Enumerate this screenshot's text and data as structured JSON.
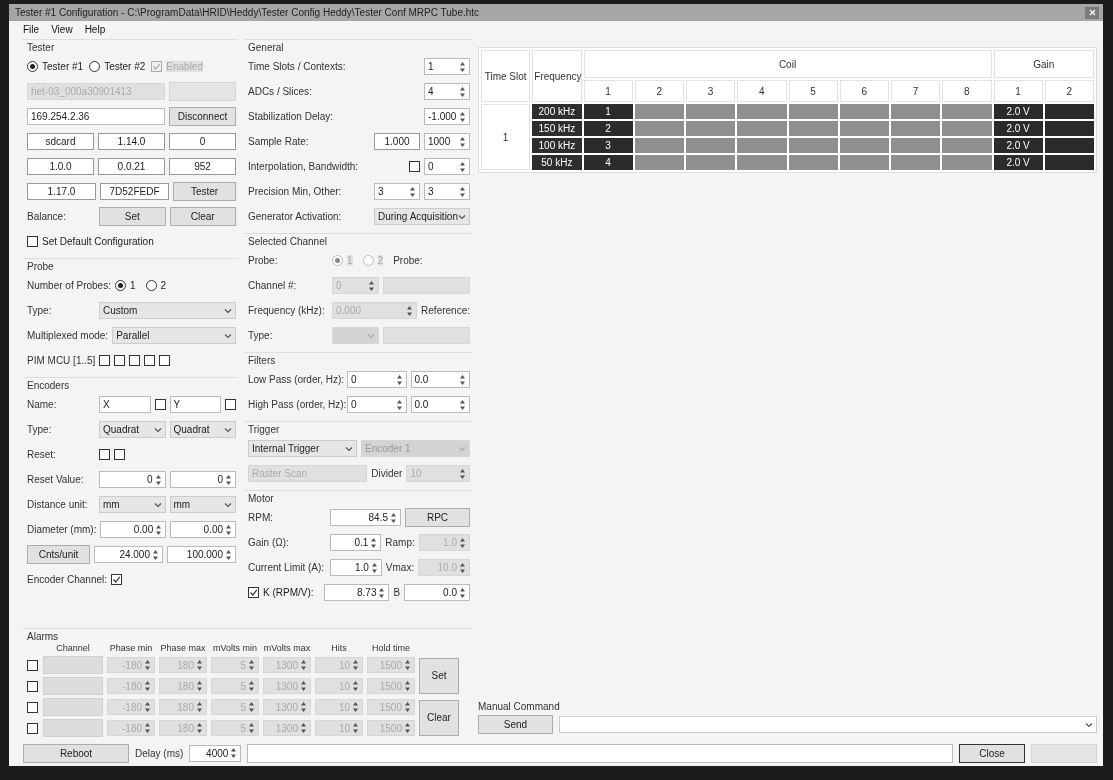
{
  "window": {
    "title": "Tester #1 Configuration - C:\\ProgramData\\HRID\\Heddy\\Tester Config Heddy\\Tester Conf MRPC Tube.htc"
  },
  "menu": [
    {
      "label": "File"
    },
    {
      "label": "View"
    },
    {
      "label": "Help"
    }
  ],
  "left_sections": [
    {
      "title": "Tester",
      "options": [
        {
          "kind": "radio",
          "label": "Tester #1",
          "selected": true,
          "disabled": false
        },
        {
          "kind": "radio",
          "label": "Tester #2",
          "selected": false,
          "disabled": false
        },
        {
          "kind": "check",
          "label": "Enabled",
          "checked": true,
          "disabled": true
        }
      ],
      "fields": [
        [
          {
            "kind": "field",
            "value": "het-03_000a30901413",
            "disabled": true
          },
          {
            "kind": "button",
            "disabled": true
          }
        ],
        [
          {
            "kind": "field",
            "value": "169.254.2.36",
            "disabled": false
          },
          {
            "kind": "button",
            "label": "Disconnect",
            "disabled": false
          }
        ]
      ],
      "readouts": [
        [
          {
            "kind": "box",
            "value": "sdcard"
          },
          {
            "kind": "box",
            "value": "1.14.0"
          },
          {
            "kind": "box",
            "value": "0"
          }
        ],
        [
          {
            "kind": "box",
            "value": "1.0.0"
          },
          {
            "kind": "box",
            "value": "0.0.21"
          },
          {
            "kind": "box",
            "value": "952"
          }
        ],
        [
          {
            "kind": "box",
            "value": "1.17.0"
          },
          {
            "kind": "box",
            "value": "7D52FEDF"
          },
          {
            "kind": "button",
            "label": "Tester",
            "disabled": false
          }
        ]
      ],
      "rows": [
        [
          {
            "kind": "label",
            "text": "Balance:"
          },
          {
            "kind": "button",
            "label": "Set",
            "disabled": false
          },
          {
            "kind": "button",
            "label": "Clear",
            "disabled": false
          }
        ],
        [
          {
            "kind": "check",
            "label": "Set Default Configuration",
            "checked": false,
            "disabled": false
          }
        ]
      ]
    },
    {
      "title": "Probe",
      "rows": [
        [
          {
            "kind": "label",
            "text": "Number of Probes:"
          },
          {
            "kind": "radio",
            "label": "1",
            "selected": true,
            "disabled": false
          },
          {
            "kind": "radio",
            "label": "2",
            "selected": false,
            "disabled": false
          }
        ],
        [
          {
            "kind": "label",
            "text": "Type:"
          },
          {
            "kind": "combo",
            "value": "Custom",
            "disabled": false
          }
        ],
        [
          {
            "kind": "label",
            "text": "Multiplexed mode:"
          },
          {
            "kind": "combo",
            "value": "Parallel",
            "disabled": false
          }
        ],
        [
          {
            "kind": "label",
            "text": "PIM MCU [1..5]"
          },
          {
            "kind": "check",
            "checked": false,
            "disabled": false
          },
          {
            "kind": "check",
            "checked": false,
            "disabled": false
          },
          {
            "kind": "check",
            "checked": false,
            "disabled": false
          },
          {
            "kind": "check",
            "checked": false,
            "disabled": false
          },
          {
            "kind": "check",
            "checked": false,
            "disabled": false
          }
        ]
      ]
    },
    {
      "title": "Encoders",
      "rows": [
        [
          {
            "kind": "label",
            "text": "Name:"
          },
          {
            "kind": "field",
            "value": "X",
            "disabled": false
          },
          {
            "kind": "check",
            "checked": false,
            "disabled": false
          },
          {
            "kind": "field",
            "value": "Y",
            "disabled": false
          },
          {
            "kind": "check",
            "checked": false,
            "disabled": false
          }
        ],
        [
          {
            "kind": "label",
            "text": "Type:"
          },
          {
            "kind": "combo",
            "value": "Quadrat",
            "disabled": false
          },
          {
            "kind": "combo",
            "value": "Quadrat",
            "disabled": false
          }
        ],
        [
          {
            "kind": "label",
            "text": "Reset:"
          },
          {
            "kind": "check",
            "checked": false,
            "disabled": false
          },
          {
            "kind": "check",
            "checked": false,
            "disabled": false
          }
        ],
        [
          {
            "kind": "label",
            "text": "Reset Value:"
          },
          {
            "kind": "spin",
            "value": "0",
            "disabled": false
          },
          {
            "kind": "spin",
            "value": "0",
            "disabled": false
          }
        ],
        [
          {
            "kind": "label",
            "text": "Distance unit:"
          },
          {
            "kind": "combo",
            "value": "mm",
            "disabled": false
          },
          {
            "kind": "combo",
            "value": "mm",
            "disabled": false
          }
        ],
        [
          {
            "kind": "label",
            "text": "Diameter (mm):"
          },
          {
            "kind": "spin",
            "value": "0.00",
            "disabled": false
          },
          {
            "kind": "spin",
            "value": "0.00",
            "disabled": false
          }
        ],
        [
          {
            "kind": "button",
            "label": "Cnts/unit",
            "disabled": false
          },
          {
            "kind": "spin",
            "value": "24.000",
            "disabled": false
          },
          {
            "kind": "spin",
            "value": "100.000",
            "disabled": false
          }
        ],
        [
          {
            "kind": "label",
            "text": "Encoder Channel:"
          },
          {
            "kind": "check",
            "checked": true,
            "disabled": false
          }
        ]
      ]
    }
  ],
  "middle_sections": [
    {
      "title": "General",
      "rows": [
        [
          {
            "kind": "label",
            "text": "Time Slots / Contexts:"
          },
          {
            "kind": "spin",
            "value": "1",
            "disabled": false
          }
        ],
        [
          {
            "kind": "label",
            "text": "ADCs / Slices:"
          },
          {
            "kind": "spin",
            "value": "4",
            "disabled": false
          }
        ],
        [
          {
            "kind": "label",
            "text": "Stabilization Delay:"
          },
          {
            "kind": "spin",
            "value": "-1.000",
            "disabled": false
          }
        ],
        [
          {
            "kind": "label",
            "text": "Sample Rate:"
          },
          {
            "kind": "box",
            "value": "1.000"
          },
          {
            "kind": "spin",
            "value": "1000",
            "disabled": false
          }
        ],
        [
          {
            "kind": "label",
            "text": "Interpolation, Bandwidth:"
          },
          {
            "kind": "check",
            "checked": false,
            "disabled": false
          },
          {
            "kind": "spin",
            "value": "0",
            "disabled": false
          }
        ],
        [
          {
            "kind": "label",
            "text": "Precision Min, Other:"
          },
          {
            "kind": "spin",
            "value": "3",
            "disabled": false
          },
          {
            "kind": "spin",
            "value": "3",
            "disabled": false
          }
        ],
        [
          {
            "kind": "label",
            "text": "Generator Activation:"
          },
          {
            "kind": "combo",
            "value": "During Acquisition",
            "disabled": false
          }
        ]
      ]
    },
    {
      "title": "Selected Channel",
      "rows": [
        [
          {
            "kind": "label",
            "text": "Probe:"
          },
          {
            "kind": "radio",
            "label": "1",
            "selected": true,
            "disabled": true
          },
          {
            "kind": "radio",
            "label": "2",
            "selected": false,
            "disabled": true
          },
          {
            "kind": "label",
            "text": "Probe:"
          }
        ],
        [
          {
            "kind": "label",
            "text": "Channel #:"
          },
          {
            "kind": "spin",
            "value": "0",
            "disabled": true
          },
          {
            "kind": "field",
            "disabled": true
          }
        ],
        [
          {
            "kind": "label",
            "text": "Frequency (kHz):"
          },
          {
            "kind": "spin",
            "value": "0.000",
            "disabled": true
          },
          {
            "kind": "label",
            "text": "Reference:"
          }
        ],
        [
          {
            "kind": "label",
            "text": "Type:"
          },
          {
            "kind": "combo",
            "disabled": true
          },
          {
            "kind": "field",
            "disabled": true
          }
        ]
      ]
    },
    {
      "title": "Filters",
      "rows": [
        [
          {
            "kind": "label",
            "text": "Low Pass (order, Hz):"
          },
          {
            "kind": "spin",
            "value": "0",
            "disabled": false
          },
          {
            "kind": "spin",
            "value": "0.0",
            "disabled": false
          }
        ],
        [
          {
            "kind": "label",
            "text": "High Pass (order, Hz):"
          },
          {
            "kind": "spin",
            "value": "0",
            "disabled": false
          },
          {
            "kind": "spin",
            "value": "0.0",
            "disabled": false
          }
        ]
      ]
    },
    {
      "title": "Trigger",
      "rows": [
        [
          {
            "kind": "combo",
            "value": "Internal Trigger",
            "disabled": false
          },
          {
            "kind": "combo",
            "value": "Encoder 1",
            "disabled": true
          }
        ],
        [
          {
            "kind": "field",
            "value": "Raster Scan",
            "disabled": true
          },
          {
            "kind": "label",
            "text": "Divider"
          },
          {
            "kind": "spin",
            "value": "10",
            "disabled": true
          }
        ]
      ]
    },
    {
      "title": "Motor",
      "rows": [
        [
          {
            "kind": "label",
            "text": "RPM:"
          },
          {
            "kind": "spin",
            "value": "84.5",
            "disabled": false
          },
          {
            "kind": "button",
            "label": "RPC",
            "disabled": false
          }
        ],
        [
          {
            "kind": "label",
            "text": "Gain (Ω):"
          },
          {
            "kind": "spin",
            "value": "0.1",
            "disabled": false
          },
          {
            "kind": "label",
            "text": "Ramp:"
          },
          {
            "kind": "spin",
            "value": "1.0",
            "disabled": true
          }
        ],
        [
          {
            "kind": "label",
            "text": "Current Limit (A):"
          },
          {
            "kind": "spin",
            "value": "1.0",
            "disabled": false
          },
          {
            "kind": "label",
            "text": "Vmax:"
          },
          {
            "kind": "spin",
            "value": "10.0",
            "disabled": true
          }
        ],
        [
          {
            "kind": "check",
            "label": "K (RPM/V):",
            "checked": true,
            "disabled": false
          },
          {
            "kind": "spin",
            "value": "8.73",
            "disabled": false
          },
          {
            "kind": "label",
            "text": "B"
          },
          {
            "kind": "spin",
            "value": "0.0",
            "disabled": false
          }
        ]
      ]
    }
  ],
  "alarms": {
    "title": "Alarms",
    "columns": [
      "Channel",
      "Phase min",
      "Phase max",
      "mVolts min",
      "mVolts max",
      "Hits",
      "Hold time"
    ],
    "rows": [
      {
        "checked": false,
        "values": [
          "-180",
          "180",
          "5",
          "1300",
          "10",
          "1500"
        ]
      },
      {
        "checked": false,
        "values": [
          "-180",
          "180",
          "5",
          "1300",
          "10",
          "1500"
        ]
      },
      {
        "checked": false,
        "values": [
          "-180",
          "180",
          "5",
          "1300",
          "10",
          "1500"
        ]
      },
      {
        "checked": false,
        "values": [
          "-180",
          "180",
          "5",
          "1300",
          "10",
          "1500"
        ]
      }
    ],
    "buttons": [
      {
        "label": "Set"
      },
      {
        "label": "Clear"
      }
    ]
  },
  "channel_table": {
    "columns": {
      "time_slot": "Time Slot",
      "frequency": "Frequency",
      "coil": "Coil",
      "coil_numbers": [
        "1",
        "2",
        "3",
        "4",
        "5",
        "6",
        "7",
        "8"
      ],
      "gain": "Gain",
      "gain_numbers": [
        "1",
        "2"
      ]
    },
    "time_slot": "1",
    "rows": [
      {
        "frequency": "200 kHz",
        "coils": [
          {
            "text": "1",
            "on": true
          },
          {
            "on": false
          },
          {
            "on": false
          },
          {
            "on": false
          },
          {
            "on": false
          },
          {
            "on": false
          },
          {
            "on": false
          },
          {
            "on": false
          }
        ],
        "gains": [
          {
            "text": "2.0 V",
            "on": true
          },
          {
            "on": true
          }
        ]
      },
      {
        "frequency": "150 kHz",
        "coils": [
          {
            "text": "2",
            "on": true
          },
          {
            "on": false
          },
          {
            "on": false
          },
          {
            "on": false
          },
          {
            "on": false
          },
          {
            "on": false
          },
          {
            "on": false
          },
          {
            "on": false
          }
        ],
        "gains": [
          {
            "text": "2.0 V",
            "on": true
          },
          {
            "on": true
          }
        ]
      },
      {
        "frequency": "100 kHz",
        "coils": [
          {
            "text": "3",
            "on": true
          },
          {
            "on": false
          },
          {
            "on": false
          },
          {
            "on": false
          },
          {
            "on": false
          },
          {
            "on": false
          },
          {
            "on": false
          },
          {
            "on": false
          }
        ],
        "gains": [
          {
            "text": "2.0 V",
            "on": true
          },
          {
            "on": true
          }
        ]
      },
      {
        "frequency": "50 kHz",
        "coils": [
          {
            "text": "4",
            "on": true
          },
          {
            "on": false
          },
          {
            "on": false
          },
          {
            "on": false
          },
          {
            "on": false
          },
          {
            "on": false
          },
          {
            "on": false
          },
          {
            "on": false
          }
        ],
        "gains": [
          {
            "text": "2.0 V",
            "on": true
          },
          {
            "on": true
          }
        ]
      }
    ]
  },
  "manual_command": {
    "label": "Manual Command",
    "button": "Send"
  },
  "bottom_bar": {
    "reboot": "Reboot",
    "delay_label": "Delay (ms)",
    "delay": "4000",
    "close": "Close"
  }
}
